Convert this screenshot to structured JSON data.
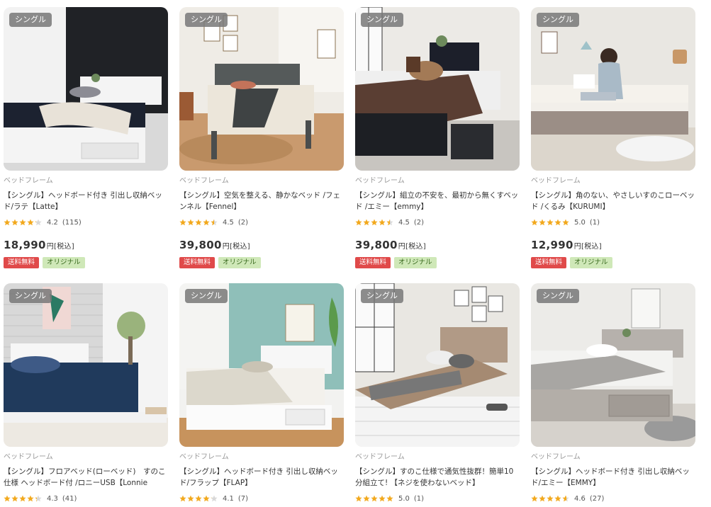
{
  "colors": {
    "star": "#f2a91e",
    "star_empty": "#d8d8d8",
    "ship_tag": "#e04a4a",
    "orig_tag": "#cfe8b8"
  },
  "products": [
    {
      "badge": "シングル",
      "category": "ベッドフレーム",
      "title": "【シングル】ヘッドボード付き 引出し収納ベッド/ラテ【Latte】",
      "rating": "4.2",
      "stars": 4.2,
      "count": "(115)",
      "price": "18,990",
      "unit": "円[税込]",
      "tag_ship": "送料無料",
      "tag_orig": "オリジナル",
      "scene": "white-bed-dark-wall"
    },
    {
      "badge": "シングル",
      "category": "ベッドフレーム",
      "title": "【シングル】空気を整える、静かなベッド /フェンネル【Fennel】",
      "rating": "4.5",
      "stars": 4.5,
      "count": "(2)",
      "price": "39,800",
      "unit": "円[税込]",
      "tag_ship": "送料無料",
      "tag_orig": "オリジナル",
      "scene": "gray-wood-bed"
    },
    {
      "badge": "シングル",
      "category": "ベッドフレーム",
      "title": "【シングル】組立の不安を、最初から無くすベッド /エミー【emmy】",
      "rating": "4.5",
      "stars": 4.5,
      "count": "(2)",
      "price": "39,800",
      "unit": "円[税込]",
      "tag_ship": "送料無料",
      "tag_orig": "オリジナル",
      "scene": "black-storage-bed"
    },
    {
      "badge": "シングル",
      "category": "ベッドフレーム",
      "title": "【シングル】角のない、やさしいすのこローベッド /くるみ【KURUMI】",
      "rating": "5.0",
      "stars": 5.0,
      "count": "(1)",
      "price": "12,990",
      "unit": "円[税込]",
      "tag_ship": "送料無料",
      "tag_orig": "オリジナル",
      "scene": "low-bed-woman"
    },
    {
      "badge": "シングル",
      "category": "ベッドフレーム",
      "title": "【シングル】フロアベッド(ローベッド)　すのこ仕様 ヘッドボード付 /ロニーUSB【Lonnie USB】",
      "rating": "4.3",
      "stars": 4.3,
      "count": "(41)",
      "scene": "floor-bed-navy"
    },
    {
      "badge": "シングル",
      "category": "ベッドフレーム",
      "title": "【シングル】ヘッドボード付き 引出し収納ベッド/フラップ【FLAP】",
      "rating": "4.1",
      "stars": 4.1,
      "count": "(7)",
      "scene": "white-bed-teal-wall"
    },
    {
      "badge": "シングル",
      "category": "ベッドフレーム",
      "title": "【シングル】すのこ仕様で通気性抜群！簡単10分組立て! 【ネジを使わないベッド】",
      "rating": "5.0",
      "stars": 5.0,
      "count": "(1)",
      "scene": "slatted-wood-bed"
    },
    {
      "badge": "シングル",
      "category": "ベッドフレーム",
      "title": "【シングル】ヘッドボード付き 引出し収納ベッド/エミー【EMMY】",
      "rating": "4.6",
      "stars": 4.6,
      "count": "(27)",
      "scene": "gray-storage-bed"
    }
  ]
}
